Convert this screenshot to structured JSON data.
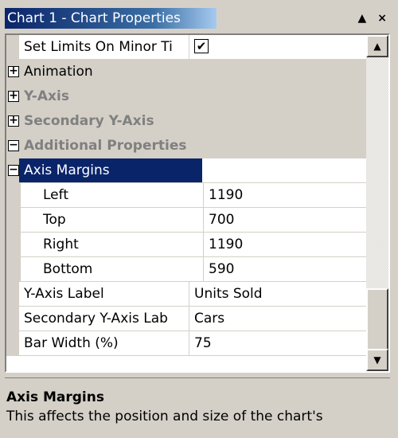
{
  "window": {
    "title": "Chart 1 - Chart Properties",
    "pin_icon": "▲",
    "close_icon": "×"
  },
  "grid": {
    "rows": [
      {
        "type": "prop",
        "name": "Set Limits On Minor Ti",
        "value": "✔",
        "checkbox": true
      },
      {
        "type": "cat",
        "expander": "+",
        "name": "Animation",
        "style": "plain"
      },
      {
        "type": "cat",
        "expander": "+",
        "name": "Y-Axis",
        "style": "grey"
      },
      {
        "type": "cat",
        "expander": "+",
        "name": "Secondary Y-Axis",
        "style": "grey"
      },
      {
        "type": "cat",
        "expander": "−",
        "name": "Additional Properties",
        "style": "grey"
      },
      {
        "type": "cat",
        "expander": "−",
        "name": "Axis Margins",
        "style": "selected"
      },
      {
        "type": "child",
        "name": "Left",
        "value": "1190"
      },
      {
        "type": "child",
        "name": "Top",
        "value": "700"
      },
      {
        "type": "child",
        "name": "Right",
        "value": "1190"
      },
      {
        "type": "child",
        "name": "Bottom",
        "value": "590"
      },
      {
        "type": "prop",
        "name": "Y-Axis Label",
        "value": "Units Sold"
      },
      {
        "type": "prop",
        "name": "Secondary Y-Axis Lab",
        "value": "Cars"
      },
      {
        "type": "prop",
        "name": "Bar Width (%)",
        "value": "75"
      }
    ]
  },
  "scrollbar": {
    "up_icon": "▲",
    "down_icon": "▼",
    "position": 0.9
  },
  "description": {
    "title": "Axis Margins",
    "text": "This affects the position and size of the chart's"
  }
}
